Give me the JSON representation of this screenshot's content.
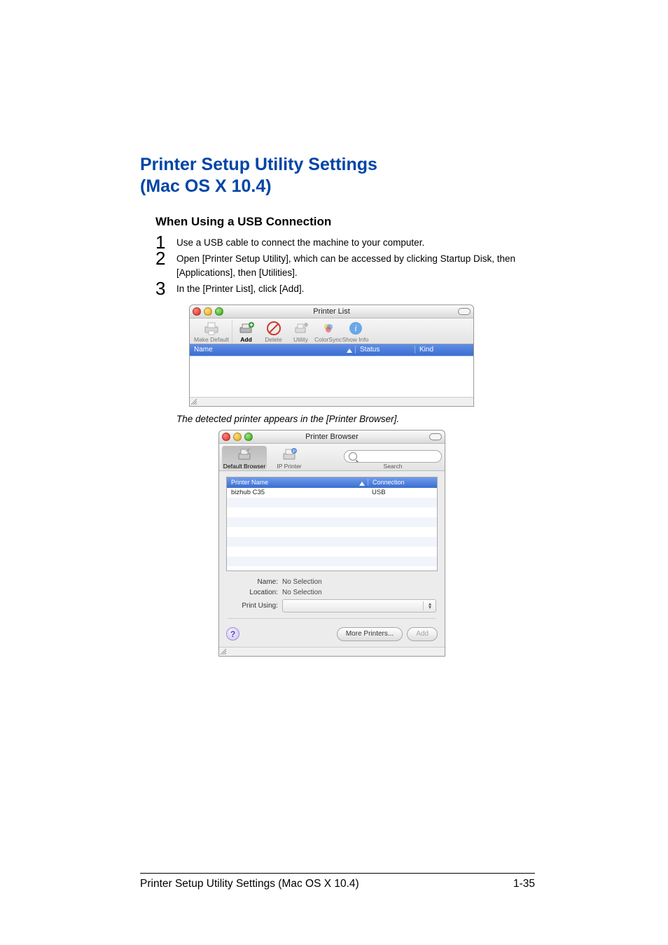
{
  "section_title_line1": "Printer Setup Utility Settings",
  "section_title_line2": "(Mac OS X 10.4)",
  "sub_title": "When Using a USB Connection",
  "steps": [
    "Use a USB cable to connect the machine to your computer.",
    "Open [Printer Setup Utility], which can be accessed by clicking Startup Disk, then [Applications], then [Utilities].",
    "In the [Printer List], click [Add]."
  ],
  "caption": "The detected printer appears in the [Printer Browser].",
  "window1": {
    "title": "Printer List",
    "toolbar": {
      "make_default": "Make Default",
      "add": "Add",
      "delete": "Delete",
      "utility": "Utility",
      "colorsync": "ColorSync",
      "show_info": "Show Info"
    },
    "columns": {
      "name": "Name",
      "status": "Status",
      "kind": "Kind"
    }
  },
  "window2": {
    "title": "Printer Browser",
    "toolbar": {
      "default_browser": "Default Browser",
      "ip_printer": "IP Printer",
      "search_placeholder": "Q-",
      "search_label": "Search"
    },
    "columns": {
      "printer_name": "Printer Name",
      "connection": "Connection"
    },
    "rows": [
      {
        "name": "bizhub C35",
        "connection": "USB"
      }
    ],
    "form": {
      "name_label": "Name:",
      "name_value": "No Selection",
      "location_label": "Location:",
      "location_value": "No Selection",
      "print_using_label": "Print Using:"
    },
    "buttons": {
      "more_printers": "More Printers...",
      "add": "Add"
    },
    "help": "?"
  },
  "footer": {
    "left": "Printer Setup Utility Settings (Mac OS X 10.4)",
    "right": "1-35"
  }
}
